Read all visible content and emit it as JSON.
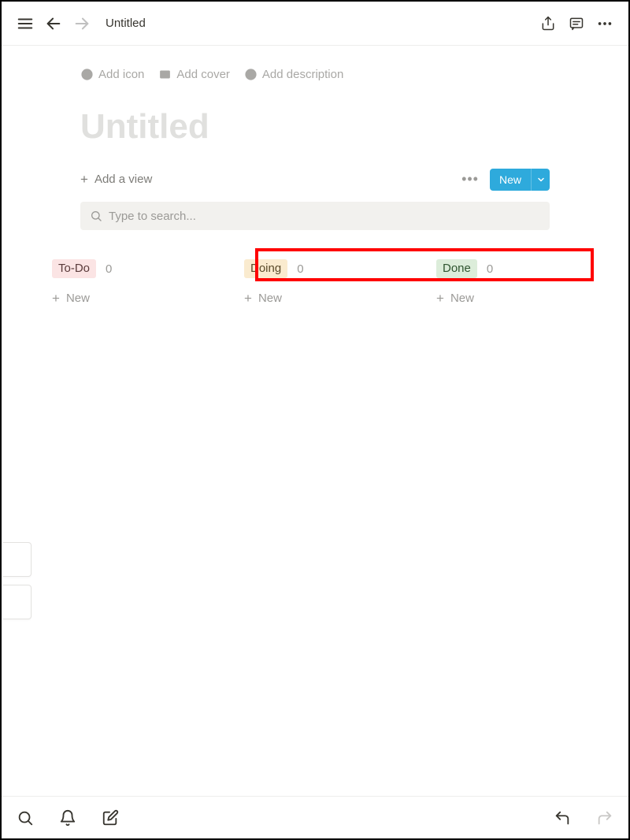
{
  "breadcrumb": "Untitled",
  "header": {
    "add_icon_label": "Add icon",
    "add_cover_label": "Add cover",
    "add_description_label": "Add description",
    "title": "Untitled"
  },
  "views": {
    "add_view_label": "Add a view",
    "new_button_label": "New"
  },
  "search": {
    "placeholder": "Type to search...",
    "value": ""
  },
  "board": {
    "columns": [
      {
        "tag": "To-Do",
        "tag_class": "tag-todo",
        "count": "0",
        "add_label": "New"
      },
      {
        "tag": "Doing",
        "tag_class": "tag-doing",
        "count": "0",
        "add_label": "New"
      },
      {
        "tag": "Done",
        "tag_class": "tag-done",
        "count": "0",
        "add_label": "New"
      }
    ]
  }
}
